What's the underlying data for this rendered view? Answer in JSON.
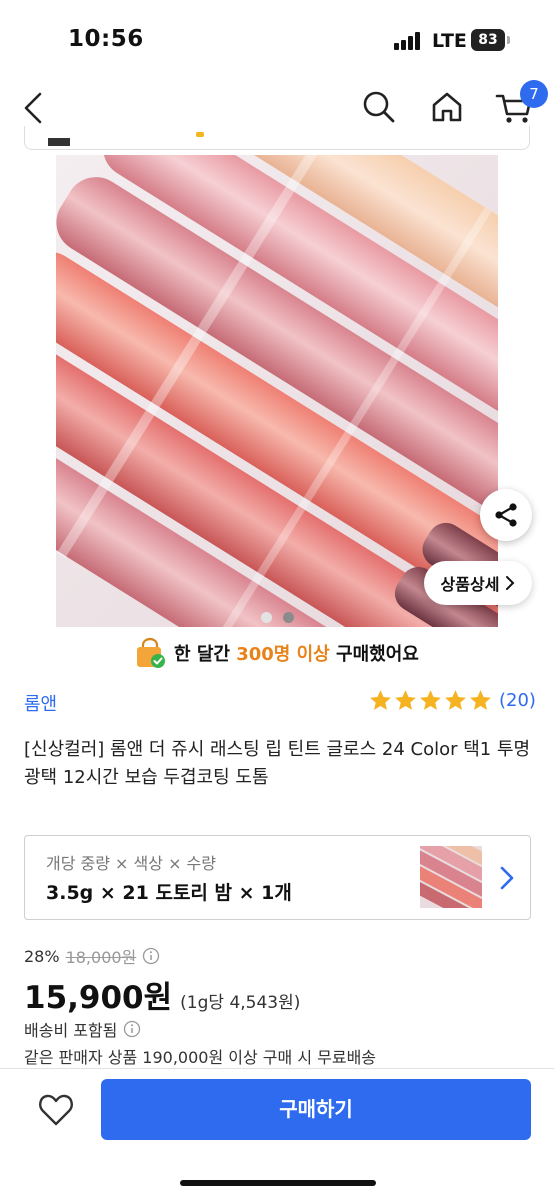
{
  "status_bar": {
    "time": "10:56",
    "network": "LTE",
    "battery": "83"
  },
  "nav": {
    "cart_count": "7",
    "icons": [
      "back-icon",
      "search-icon",
      "home-icon",
      "cart-icon"
    ]
  },
  "gallery": {
    "page_count": 2,
    "active_index": 0,
    "detail_label": "상품상세",
    "share_icon": "share-icon"
  },
  "purchase_notice": {
    "prefix": "한 달간 ",
    "highlight": "300명 이상",
    "suffix": " 구매했어요"
  },
  "product": {
    "brand": "롬앤",
    "rating": 5,
    "review_count": "(20)",
    "title": "[신상컬러] 롬앤 더 쥬시 래스팅 립 틴트 글로스 24 Color 택1 투명 광택 12시간 보습 두겹코팅 도톰"
  },
  "option": {
    "label": "개당 중량 × 색상 × 수량",
    "value": "3.5g × 21 도토리 밤 × 1개"
  },
  "pricing": {
    "discount": "28%",
    "original_price": "18,000원",
    "price": "15,900원",
    "unit_price": "(1g당 4,543원)",
    "shipping": "배송비 포함됨",
    "free_shipping_note": "같은 판매자 상품 190,000원 이상 구매 시 무료배송"
  },
  "bottom_bar": {
    "buy_label": "구매하기"
  },
  "colors": {
    "accent": "#2e6bef",
    "highlight": "#e8831a",
    "star": "#f5b321"
  }
}
